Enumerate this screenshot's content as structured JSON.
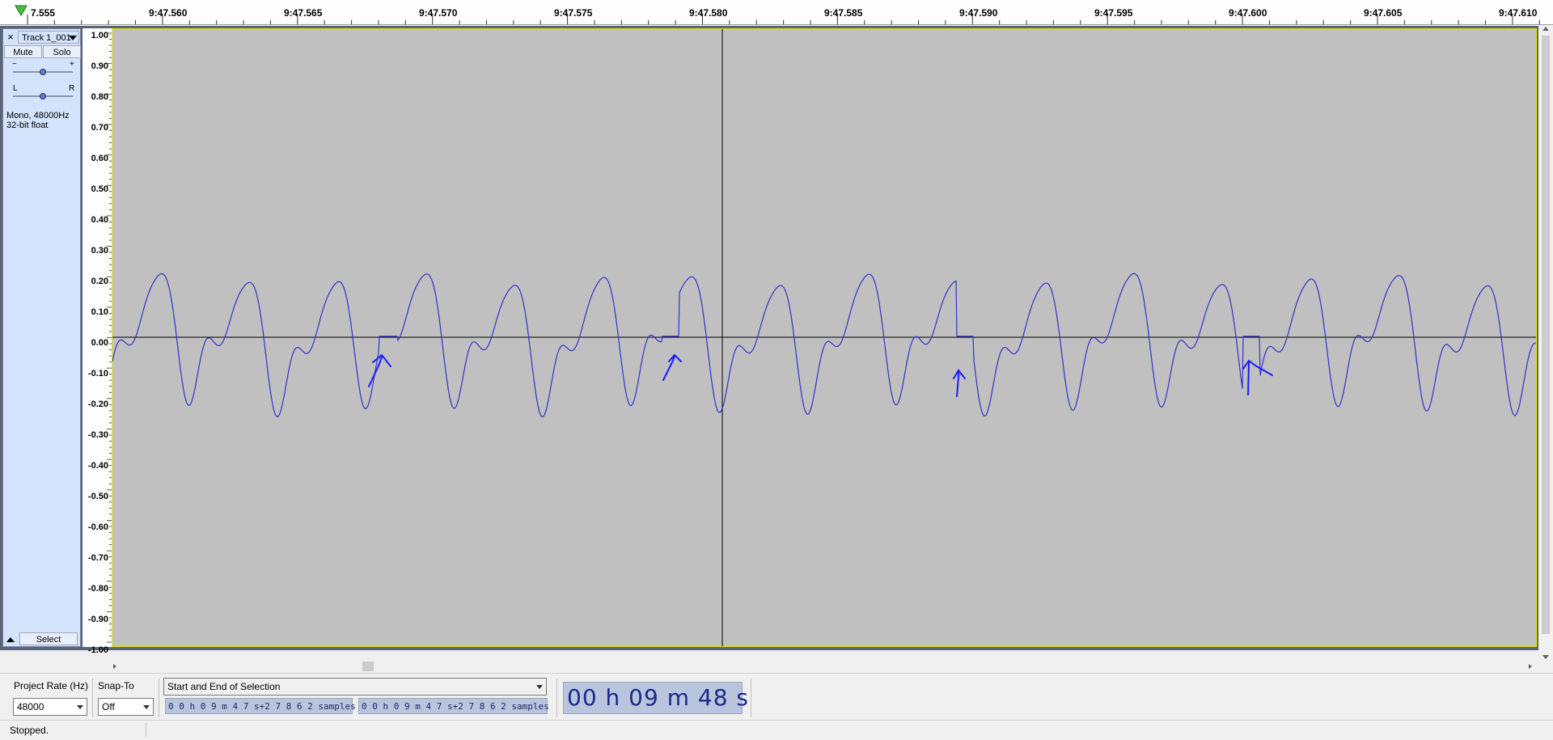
{
  "ruler": {
    "labels": [
      "7.555",
      "9:47.560",
      "9:47.565",
      "9:47.570",
      "9:47.575",
      "9:47.580",
      "9:47.585",
      "9:47.590",
      "9:47.595",
      "9:47.600",
      "9:47.605",
      "9:47.610"
    ]
  },
  "track": {
    "close_icon": "×",
    "name": "Track 1_001",
    "mute_label": "Mute",
    "solo_label": "Solo",
    "gain_minus": "−",
    "gain_plus": "+",
    "pan_left": "L",
    "pan_right": "R",
    "gain_level": 0.5,
    "pan_level": 0.5,
    "info_line1": "Mono, 48000Hz",
    "info_line2": "32-bit float",
    "select_label": "Select"
  },
  "y_axis": {
    "labels": [
      "1.00",
      "0.90",
      "0.80",
      "0.70",
      "0.60",
      "0.50",
      "0.40",
      "0.30",
      "0.20",
      "0.10",
      "0.00",
      "-0.10",
      "-0.20",
      "-0.30",
      "-0.40",
      "-0.50",
      "-0.60",
      "-0.70",
      "-0.80",
      "-0.90",
      "-1.00"
    ]
  },
  "bottom": {
    "project_rate_label": "Project Rate (Hz)",
    "project_rate_value": "48000",
    "snap_to_label": "Snap-To",
    "snap_to_value": "Off",
    "selection_mode": "Start and End of Selection",
    "selection_start": "0 0 h 0 9 m 4 7 s+2 7 8 6 2 samples",
    "selection_end": "0 0 h 0 9 m 4 7 s+2 7 8 6 2 samples",
    "audio_position": "00 h 09 m 48 s"
  },
  "status": {
    "text": "Stopped."
  },
  "colors": {
    "waveform": "#3232c8",
    "annotation": "#1a1aff",
    "background": "#c0c0c0",
    "panel": "#d3e3fb"
  }
}
